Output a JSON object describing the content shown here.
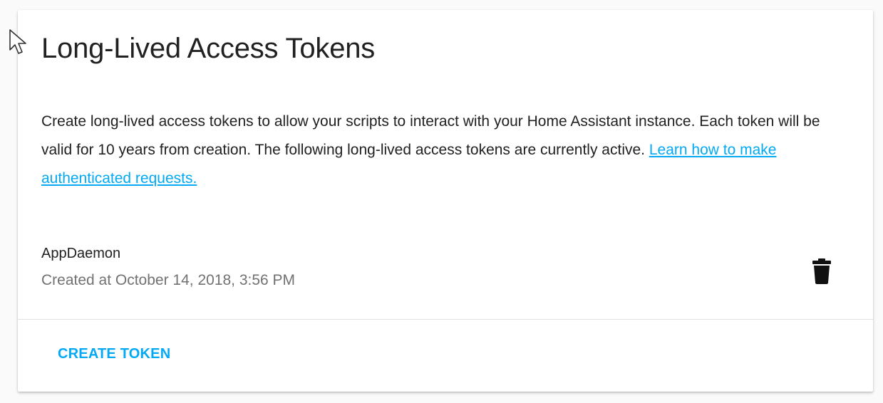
{
  "card": {
    "title": "Long-Lived Access Tokens",
    "description": "Create long-lived access tokens to allow your scripts to interact with your Home Assistant instance. Each token will be valid for 10 years from creation. The following long-lived access tokens are currently active. ",
    "learn_link": "Learn how to make authenticated requests."
  },
  "tokens": [
    {
      "name": "AppDaemon",
      "created": "Created at October 14, 2018, 3:56 PM",
      "delete_icon": "delete-icon"
    }
  ],
  "actions": {
    "create_label": "CREATE TOKEN"
  },
  "colors": {
    "accent": "#03a9f4",
    "text_primary": "#212121",
    "text_secondary": "#727272",
    "divider": "#e0e0e0"
  },
  "icons": {
    "cursor": "mouse-pointer-icon"
  }
}
